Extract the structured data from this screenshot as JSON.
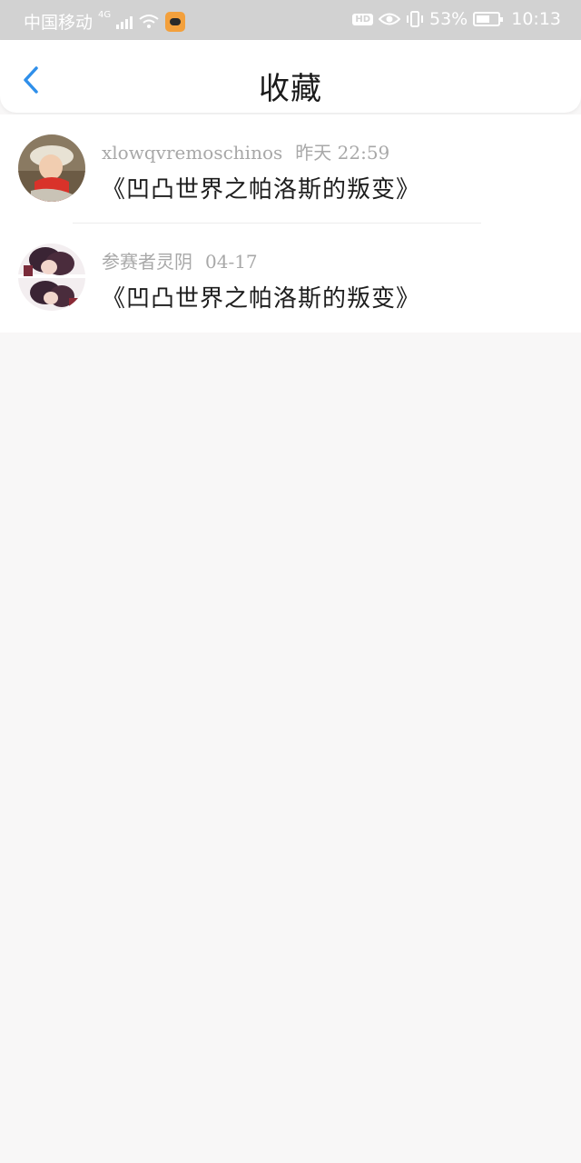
{
  "status_bar": {
    "carrier": "中国移动",
    "network": "4G",
    "battery": "53%",
    "time": "10:13"
  },
  "nav": {
    "title": "收藏"
  },
  "favorites": [
    {
      "username": "xlowqvremoschinos",
      "time": "昨天  22:59",
      "title": "《凹凸世界之帕洛斯的叛变》"
    },
    {
      "username": "参赛者灵阴",
      "time": "04-17",
      "title": "《凹凸世界之帕洛斯的叛变》"
    }
  ],
  "colors": {
    "accent": "#2f8fea",
    "statusbar": "#d2d2d2",
    "background": "#f8f7f7"
  }
}
